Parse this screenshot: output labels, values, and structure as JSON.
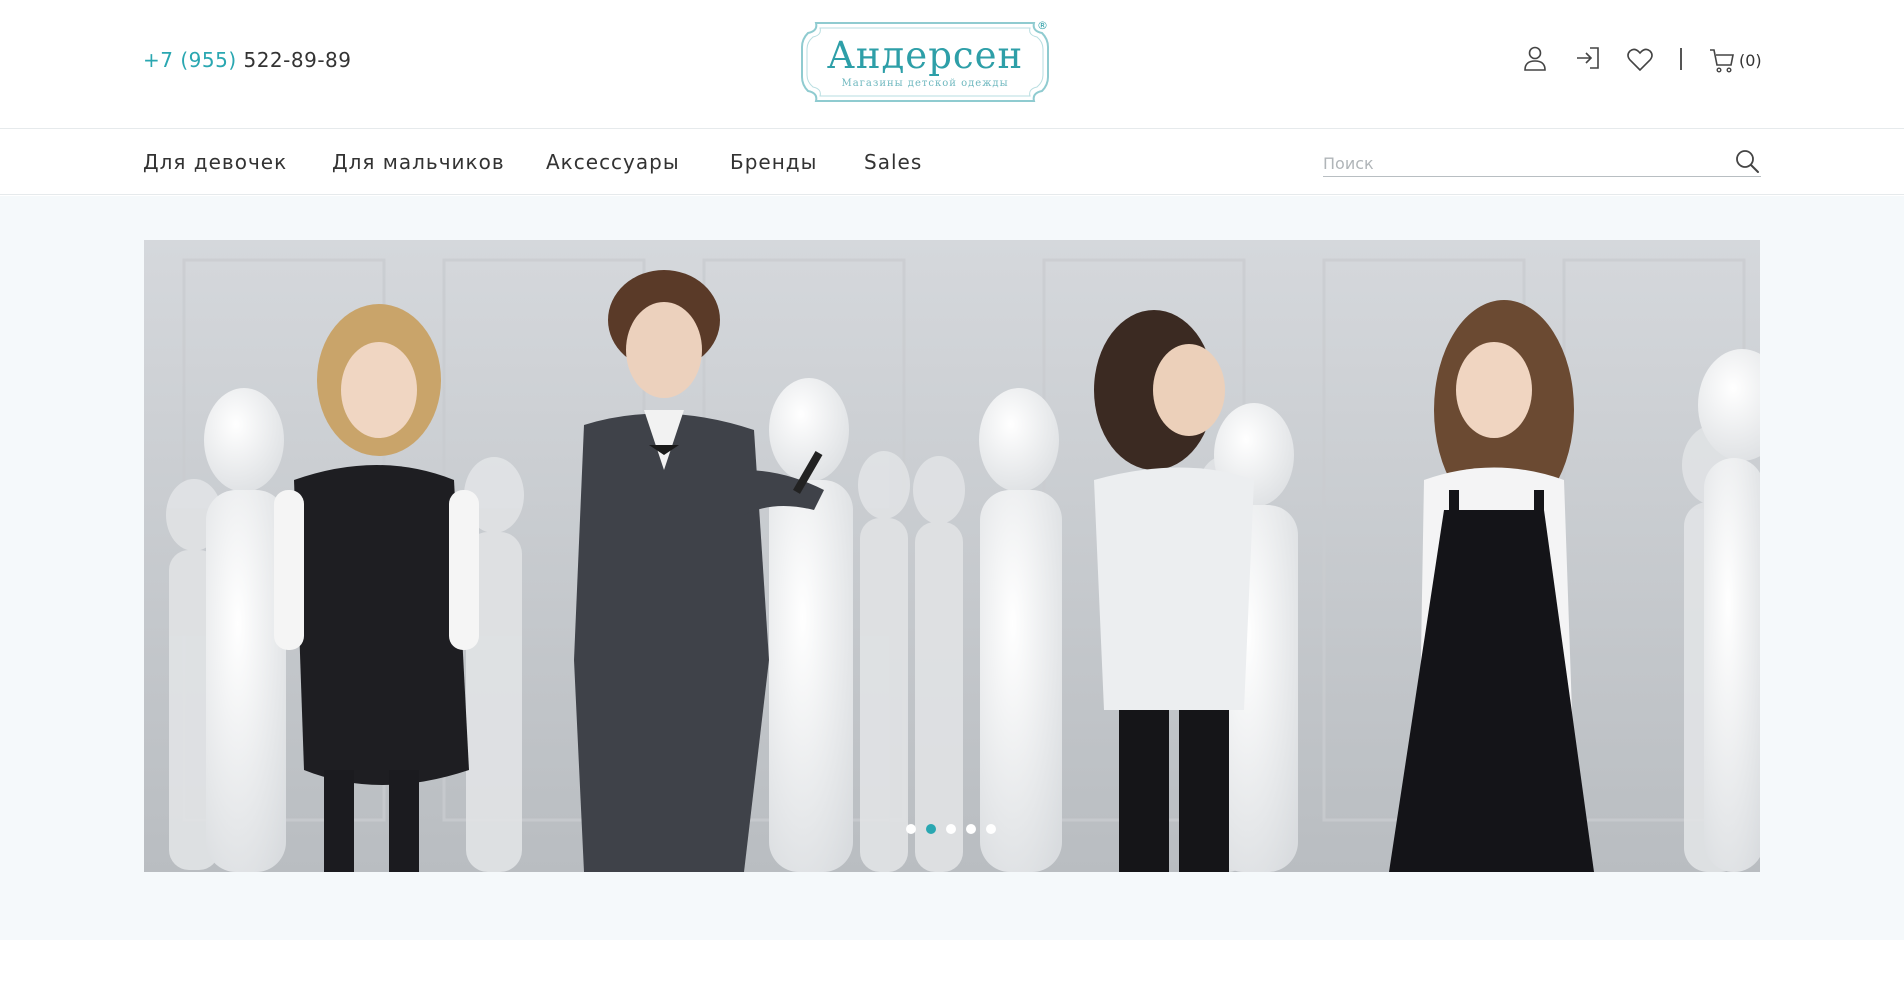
{
  "header": {
    "phone_code": "+7 (955)",
    "phone_number": " 522-89-89",
    "logo_title": "Андерсен",
    "logo_subtitle": "Магазины детской одежды",
    "logo_registered": "®",
    "icons": [
      "user-icon",
      "login-icon",
      "heart-icon",
      "cart-icon"
    ],
    "cart_count": "(0)"
  },
  "nav": {
    "items": [
      {
        "label": "Для девочек"
      },
      {
        "label": "Для мальчиков"
      },
      {
        "label": "Аксессуары"
      },
      {
        "label": "Бренды"
      },
      {
        "label": "Sales"
      }
    ],
    "search_placeholder": "Поиск"
  },
  "hero": {
    "slide_count": 5,
    "active_slide": 2
  },
  "colors": {
    "accent": "#2aa7b1",
    "text": "#333333",
    "hero_background": "#f5f9fb"
  }
}
